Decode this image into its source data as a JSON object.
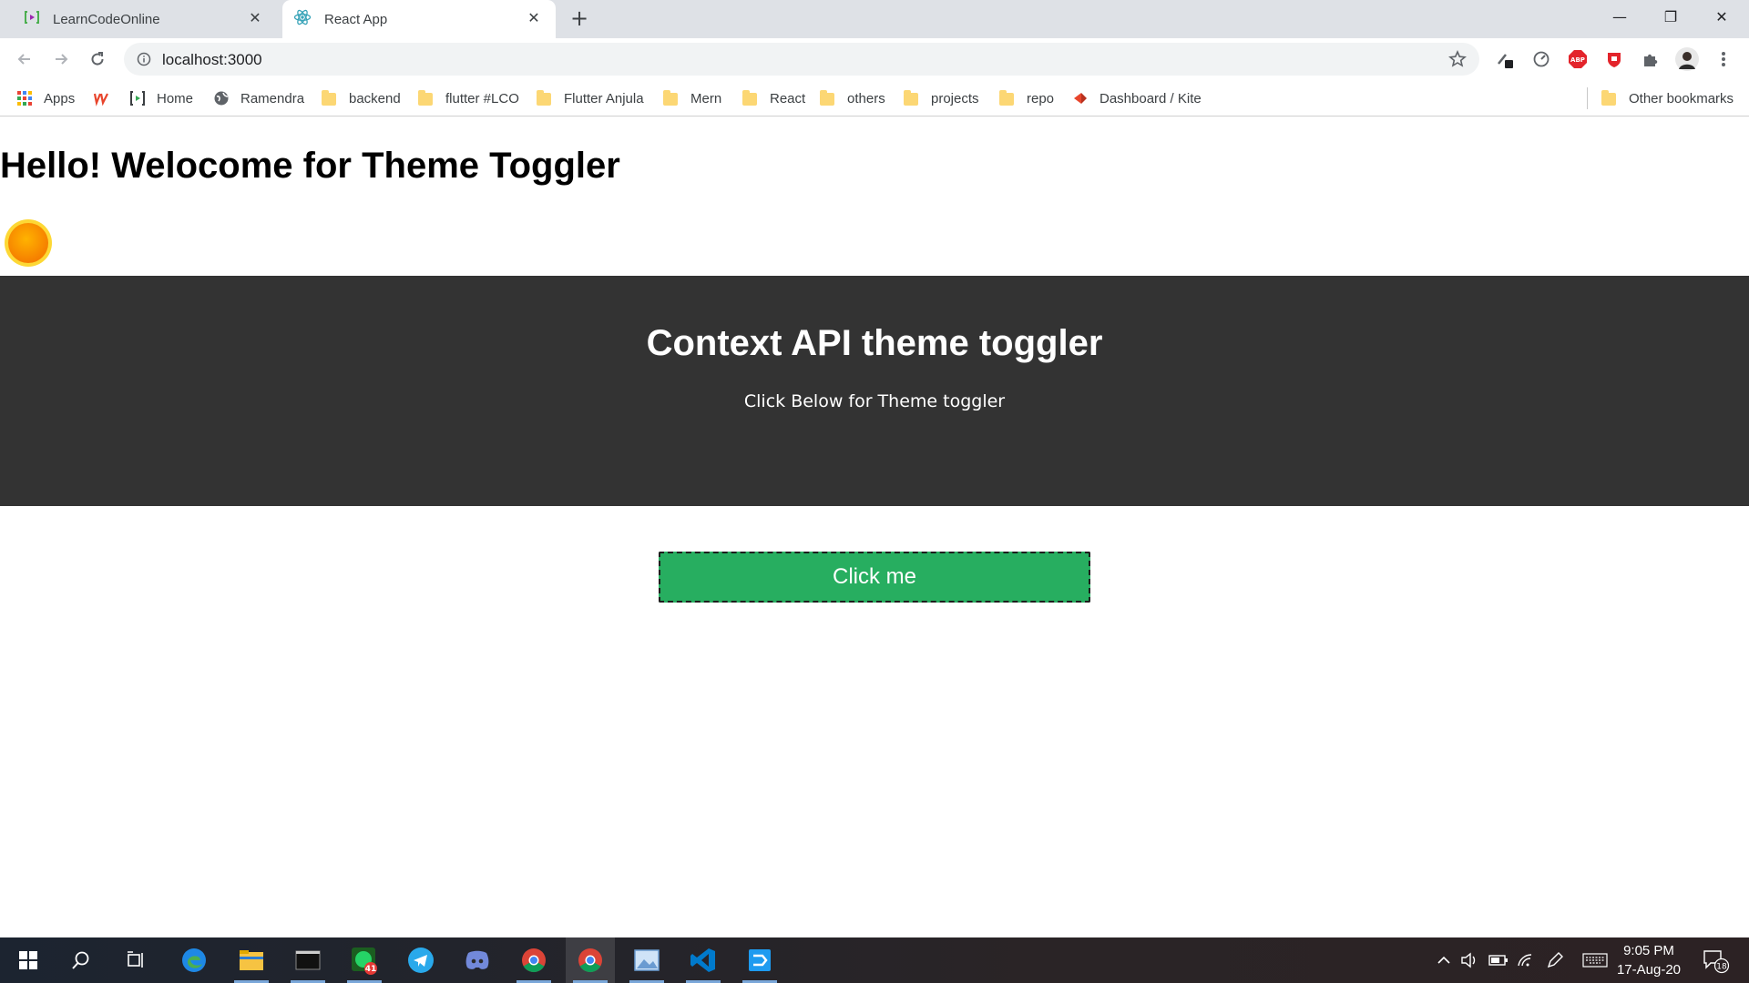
{
  "browser": {
    "tabs": [
      {
        "title": "LearnCodeOnline",
        "active": false
      },
      {
        "title": "React App",
        "active": true
      }
    ],
    "url": "localhost:3000",
    "bookmarks": [
      {
        "label": "Apps",
        "icon": "apps-grid-icon"
      },
      {
        "label": "",
        "icon": "u-logo-icon"
      },
      {
        "label": "Home",
        "icon": "lco-logo-icon"
      },
      {
        "label": "Ramendra",
        "icon": "globe-icon"
      },
      {
        "label": "backend",
        "icon": "folder-icon"
      },
      {
        "label": "flutter #LCO",
        "icon": "folder-icon"
      },
      {
        "label": "Flutter Anjula",
        "icon": "folder-icon"
      },
      {
        "label": "Mern",
        "icon": "folder-icon"
      },
      {
        "label": "React",
        "icon": "folder-icon"
      },
      {
        "label": "others",
        "icon": "folder-icon"
      },
      {
        "label": "projects",
        "icon": "folder-icon"
      },
      {
        "label": "repo",
        "icon": "folder-icon"
      },
      {
        "label": "Dashboard / Kite",
        "icon": "kite-logo-icon"
      }
    ],
    "other_bookmarks": "Other bookmarks"
  },
  "page": {
    "greeting": "Hello! Welocome for Theme Toggler",
    "theme_icon": "sun-icon",
    "section_title": "Context API theme toggler",
    "section_subtitle": "Click Below for Theme toggler",
    "button_label": "Click me"
  },
  "taskbar": {
    "time": "9:05 PM",
    "date": "17-Aug-20",
    "whatsapp_badge": "41",
    "notification_count": "18"
  },
  "colors": {
    "dark_section_bg": "#333333",
    "button_bg": "#27ae60",
    "sun": "#f39c12"
  }
}
